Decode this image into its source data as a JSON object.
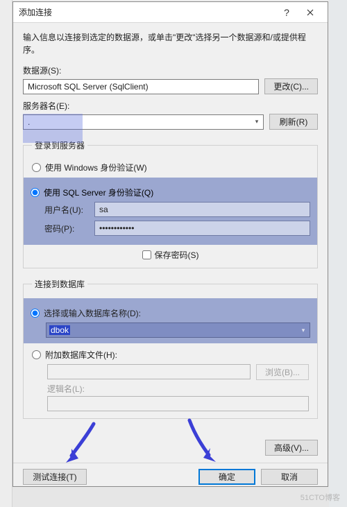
{
  "window": {
    "title": "添加连接"
  },
  "intro": "输入信息以连接到选定的数据源，或单击\"更改\"选择另一个数据源和/或提供程序。",
  "labels": {
    "dataSource": "数据源(S):",
    "change": "更改(C)...",
    "serverName": "服务器名(E):",
    "refresh": "刷新(R)",
    "loginGroup": "登录到服务器",
    "authWindows": "使用 Windows 身份验证(W)",
    "authSql": "使用 SQL Server 身份验证(Q)",
    "username": "用户名(U):",
    "password": "密码(P):",
    "savePassword": "保存密码(S)",
    "dbGroup": "连接到数据库",
    "selectDb": "选择或输入数据库名称(D):",
    "attachDb": "附加数据库文件(H):",
    "browse": "浏览(B)...",
    "logicalName": "逻辑名(L):",
    "advanced": "高级(V)...",
    "testConn": "测试连接(T)",
    "ok": "确定",
    "cancel": "取消"
  },
  "values": {
    "dataSource": "Microsoft SQL Server (SqlClient)",
    "serverName": ".",
    "username": "sa",
    "passwordMasked": "••••••••••••",
    "dbName": "dbok",
    "attachFile": "",
    "logicalName": ""
  },
  "watermark": "51CTO博客"
}
